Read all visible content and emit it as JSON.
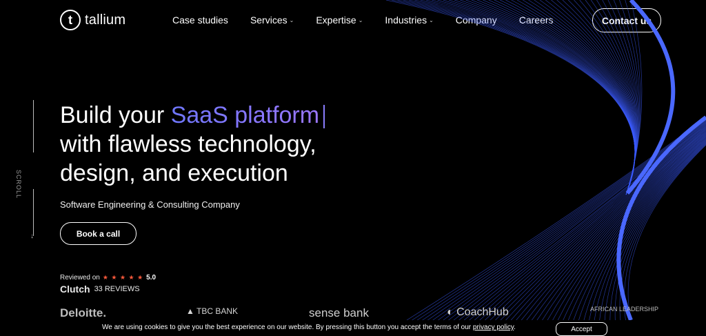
{
  "brand": {
    "name": "tallium",
    "mark": "t"
  },
  "nav": {
    "items": [
      {
        "label": "Case studies",
        "dropdown": false
      },
      {
        "label": "Services",
        "dropdown": true
      },
      {
        "label": "Expertise",
        "dropdown": true
      },
      {
        "label": "Industries",
        "dropdown": true
      },
      {
        "label": "Company",
        "dropdown": false
      },
      {
        "label": "Careers",
        "dropdown": false
      }
    ],
    "cta": "Contact us"
  },
  "scroll": {
    "label": "SCROLL"
  },
  "hero": {
    "line1_prefix": "Build your ",
    "line1_accent": "SaaS platform",
    "line2": "with flawless technology,",
    "line3": "design, and execution",
    "subtitle": "Software Engineering & Consulting Company",
    "cta": "Book a call"
  },
  "clutch": {
    "reviewed_on": "Reviewed on",
    "stars": "★ ★ ★ ★ ★",
    "rating": "5.0",
    "brand": "Clutch",
    "reviews": "33 REVIEWS"
  },
  "client_logos": [
    "Deloitte.",
    "TBC BANK",
    "sense bank",
    "CoachHub",
    "AFRICAN LEADERSHIP"
  ],
  "cookie": {
    "text": "We are using cookies to give you the best experience on our website. By pressing this button you accept the terms of our ",
    "link": "privacy policy",
    "end": ".",
    "accept": "Accept"
  },
  "colors": {
    "accent_start": "#6f77ff",
    "accent_end": "#9b77ff",
    "art_blue": "#3c5bff",
    "background": "#000000"
  }
}
